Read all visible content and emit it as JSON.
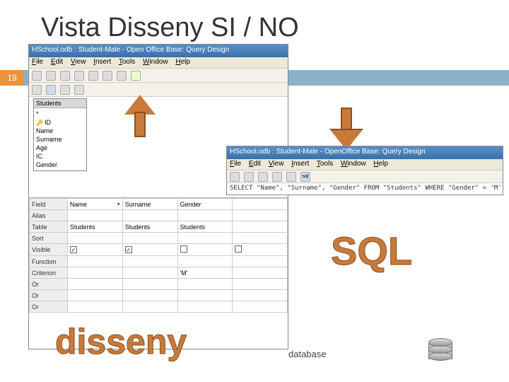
{
  "slide": {
    "title": "Vista Disseny SI / NO",
    "pagenum": "19"
  },
  "win1": {
    "title": "HSchool.odb : Student-Male - Open Office Base: Query Design",
    "menu": {
      "file": "File",
      "edit": "Edit",
      "view": "View",
      "insert": "Insert",
      "tools": "Tools",
      "window": "Window",
      "help": "Help"
    },
    "tablebox": {
      "title": "Students",
      "fields": [
        "ID",
        "Name",
        "Surname",
        "Age",
        "IC",
        "Gender"
      ]
    },
    "grid": {
      "rows": [
        "Field",
        "Alias",
        "Table",
        "Sort",
        "Visible",
        "Function",
        "Criterion",
        "Or",
        "Or",
        "Or"
      ],
      "cols": [
        {
          "field": "Name",
          "table": "Students",
          "visible": true,
          "criterion": ""
        },
        {
          "field": "Surname",
          "table": "Students",
          "visible": true,
          "criterion": ""
        },
        {
          "field": "Gender",
          "table": "Students",
          "visible": false,
          "criterion": "'M'"
        }
      ]
    }
  },
  "win2": {
    "title": "HSchool.odb : Student-Male - OpenOffice Base: Query Design",
    "menu": {
      "file": "File",
      "edit": "Edit",
      "view": "View",
      "insert": "Insert",
      "tools": "Tools",
      "window": "Window",
      "help": "Help"
    },
    "sql": "SELECT \"Name\", \"Surname\", \"Gender\" FROM \"Students\" WHERE \"Gender\" = 'M'"
  },
  "labels": {
    "sql": "SQL",
    "disseny": "disseny",
    "database": "database"
  },
  "chart_data": {
    "type": "table",
    "title": "Query design grid",
    "categories": [
      "Name",
      "Surname",
      "Gender"
    ],
    "series": [
      {
        "name": "Table",
        "values": [
          "Students",
          "Students",
          "Students"
        ]
      },
      {
        "name": "Visible",
        "values": [
          true,
          true,
          false
        ]
      },
      {
        "name": "Criterion",
        "values": [
          "",
          "",
          "'M'"
        ]
      }
    ]
  }
}
